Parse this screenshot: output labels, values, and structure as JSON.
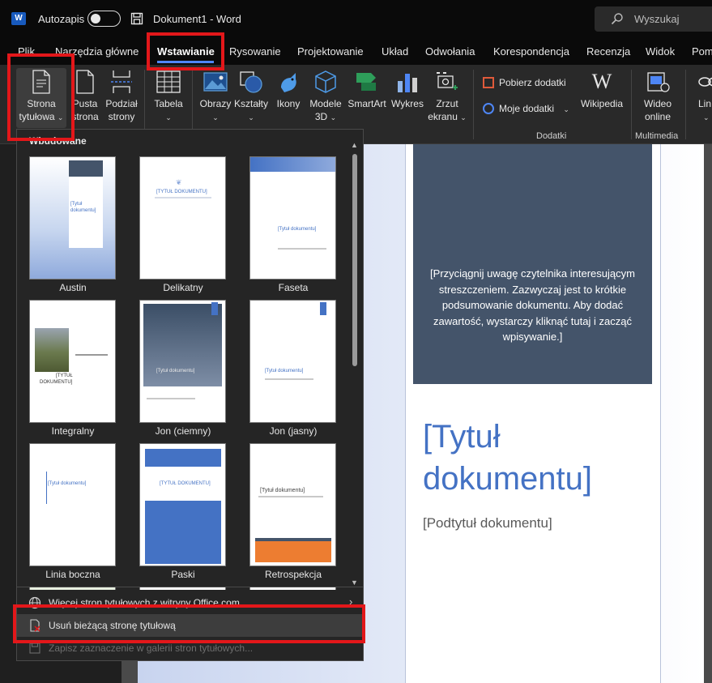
{
  "titlebar": {
    "autosave_label": "Autozapis",
    "document_title": "Dokument1 - Word",
    "search_placeholder": "Wyszukaj"
  },
  "tabs": [
    {
      "label": "Plik"
    },
    {
      "label": "Narzędzia główne"
    },
    {
      "label": "Wstawianie",
      "active": true
    },
    {
      "label": "Rysowanie"
    },
    {
      "label": "Projektowanie"
    },
    {
      "label": "Układ"
    },
    {
      "label": "Odwołania"
    },
    {
      "label": "Korespondencja"
    },
    {
      "label": "Recenzja"
    },
    {
      "label": "Widok"
    },
    {
      "label": "Pom"
    }
  ],
  "ribbon": {
    "cover_page": {
      "line1": "Strona",
      "line2": "tytułowa"
    },
    "blank_page": {
      "line1": "Pusta",
      "line2": "strona"
    },
    "page_break": {
      "line1": "Podział",
      "line2": "strony"
    },
    "table": {
      "line1": "Tabela"
    },
    "pictures": {
      "line1": "Obrazy"
    },
    "shapes": {
      "line1": "Kształty"
    },
    "icons": {
      "line1": "Ikony"
    },
    "models3d": {
      "line1": "Modele",
      "line2": "3D"
    },
    "smartart": {
      "line1": "SmartArt"
    },
    "chart": {
      "line1": "Wykres"
    },
    "screenshot": {
      "line1": "Zrzut",
      "line2": "ekranu"
    },
    "get_addins": "Pobierz dodatki",
    "my_addins": "Moje dodatki",
    "wikipedia": "Wikipedia",
    "online_video": {
      "line1": "Wideo",
      "line2": "online"
    },
    "links_partial": "Lin",
    "group_addins": "Dodatki",
    "group_media": "Multimedia"
  },
  "gallery": {
    "header": "Wbudowane",
    "items": [
      {
        "label": "Austin"
      },
      {
        "label": "Delikatny"
      },
      {
        "label": "Faseta"
      },
      {
        "label": "Integralny"
      },
      {
        "label": "Jon (ciemny)"
      },
      {
        "label": "Jon (jasny)"
      },
      {
        "label": "Linia boczna"
      },
      {
        "label": "Paski"
      },
      {
        "label": "Retrospekcja"
      }
    ],
    "thumb_texts": {
      "title_upper": "[TYTUŁ DOKUMENTU]",
      "title_mixed": "[Tytuł dokumentu]",
      "title_two_line_1": "[Tytuł",
      "title_two_line_2": "dokumentu]",
      "title_integral_1": "[TYTUŁ",
      "title_integral_2": "DOKUMENTU]"
    },
    "menu": {
      "more_online": "Więcej stron tytułowych z witryny Office.com",
      "remove_current": "Usuń bieżącą stronę tytułową",
      "save_selection": "Zapisz zaznaczenie w galerii stron tytułowych..."
    }
  },
  "document": {
    "abstract": "[Przyciągnij uwagę czytelnika interesującym streszczeniem. Zazwyczaj jest to krótkie podsumowanie dokumentu. Aby dodać zawartość, wystarczy kliknąć tutaj i zacząć wpisywanie.]",
    "title": "[Tytuł dokumentu]",
    "subtitle": "[Podtytuł dokumentu]"
  },
  "colors": {
    "accent_blue": "#4472c4",
    "highlight_red": "#e3171a",
    "abstract_bg": "#44546a",
    "tab_underline": "#4e86f5"
  }
}
